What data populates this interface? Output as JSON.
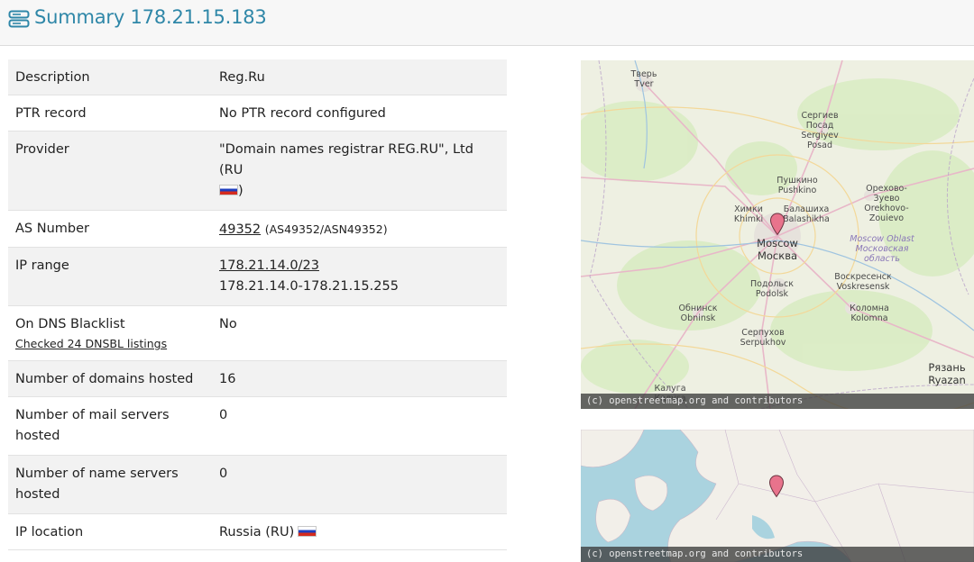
{
  "header": {
    "title": "Summary 178.21.15.183",
    "icon": "server-icon"
  },
  "summary": {
    "description": {
      "label": "Description",
      "value": "Reg.Ru"
    },
    "ptr": {
      "label": "PTR record",
      "value": "No PTR record configured"
    },
    "provider": {
      "label": "Provider",
      "value": "\"Domain names registrar REG.RU\", Ltd (RU",
      "close": ")"
    },
    "as_number": {
      "label": "AS Number",
      "value": "49352",
      "extra": "(AS49352/ASN49352)"
    },
    "ip_range": {
      "label": "IP range",
      "value": "178.21.14.0/23",
      "range": "178.21.14.0-178.21.15.255"
    },
    "dns_blacklist": {
      "label": "On DNS Blacklist",
      "link": "Checked 24 DNSBL listings",
      "value": "No"
    },
    "domains_hosted": {
      "label": "Number of domains hosted",
      "value": "16"
    },
    "mail_servers": {
      "label": "Number of mail servers hosted",
      "value": "0"
    },
    "name_servers": {
      "label": "Number of name servers hosted",
      "value": "0"
    },
    "ip_location": {
      "label": "IP location",
      "value": "Russia (RU)"
    }
  },
  "flag_colors": [
    "#ffffff",
    "#1f3fbf",
    "#d52b1e"
  ],
  "map_city": {
    "attribution": "(c) openstreetmap.org and contributors",
    "places": {
      "tver": "Тверь\nTver",
      "sergiev": "Сергиев\nПосад\nSergiyev\nPosad",
      "pushkino": "Пушкино\nPushkino",
      "orekhovo": "Орехово-\nЗуево\nOrekhovo-\nZouievo",
      "khimki": "Химки\nKhimki",
      "balashikha": "Балашиха\nBalashikha",
      "moscow": "Moscow\nМосква",
      "oblast": "Moscow Oblast\nМосковская\nобласть",
      "voskresensk": "Воскресенск\nVoskresensk",
      "podolsk": "Подольск\nPodolsk",
      "obninsk": "Обнинск\nObninsk",
      "kolomna": "Коломна\nKolomna",
      "serpukhov": "Серпухов\nSerpukhov",
      "ryazan": "Рязань\nRyazan",
      "kaluga": "Калуга\nКалуга"
    },
    "marker_color": "#e8738c"
  },
  "map_world": {
    "attribution": "(c) openstreetmap.org and contributors",
    "marker_color": "#e8738c"
  }
}
